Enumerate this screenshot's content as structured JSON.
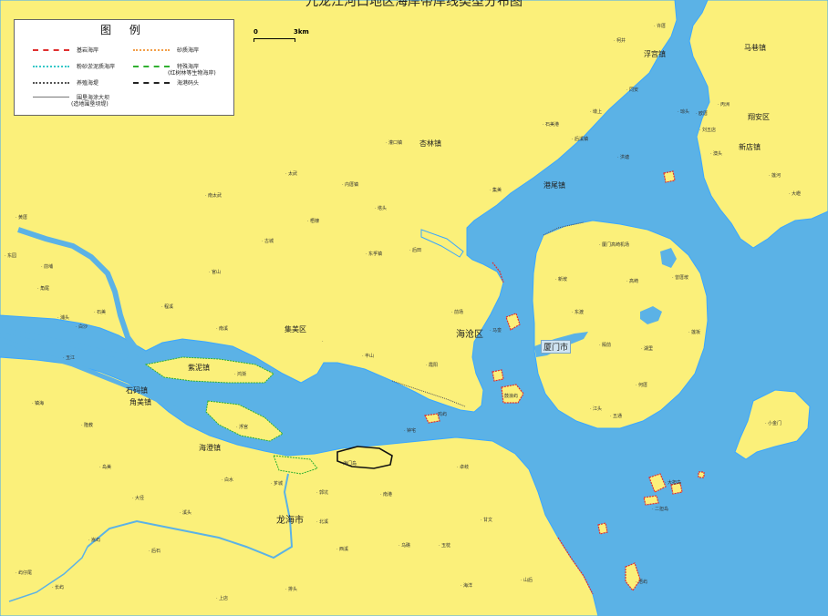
{
  "title": "九龙江河口地区海岸带岸线类型分布图",
  "legend": {
    "title": "图 例",
    "items": [
      {
        "label": "基岩海岸",
        "color": "#e03030",
        "style": "dashed"
      },
      {
        "label": "砂质海岸",
        "color": "#f2a04a",
        "style": "dotted"
      },
      {
        "label": "粉砂淤泥质海岸",
        "color": "#36c8c8",
        "style": "dotted"
      },
      {
        "label": "特殊海岸",
        "sublabel": "(红树林等生物海岸)",
        "color": "#30b030",
        "style": "dashed"
      },
      {
        "label": "养殖海堤",
        "color": "#555555",
        "style": "ticks"
      },
      {
        "label": "海港码头",
        "color": "#222222",
        "style": "crenel"
      },
      {
        "label": "围垦海涂大坝",
        "sublabel": "(造地围垦坝堤)",
        "color": "#777777",
        "style": "solid"
      }
    ]
  },
  "scale": {
    "start": "0",
    "end": "3km"
  },
  "colors": {
    "sea": "#5bb2e6",
    "land": "#fbf07a",
    "coast": "#3aa7ff"
  },
  "districts": [
    {
      "name": "厦门市",
      "style": "boxed"
    },
    {
      "name": "海沧区",
      "style": "big"
    },
    {
      "name": "龙海市",
      "style": "big"
    },
    {
      "name": "翔安区",
      "style": "big"
    },
    {
      "name": "新店镇",
      "style": "normal"
    },
    {
      "name": "马巷镇",
      "style": "normal"
    },
    {
      "name": "角美镇",
      "style": "normal"
    },
    {
      "name": "紫泥镇",
      "style": "normal"
    },
    {
      "name": "海澄镇",
      "style": "normal"
    },
    {
      "name": "港尾镇",
      "style": "normal"
    },
    {
      "name": "浮宫镇",
      "style": "normal"
    },
    {
      "name": "石码镇",
      "style": "normal"
    },
    {
      "name": "集美区",
      "style": "normal"
    },
    {
      "name": "杏林镇",
      "style": "normal"
    },
    {
      "name": "厦门高崎机场",
      "style": "normal"
    },
    {
      "name": "鼓浪屿",
      "style": "normal"
    },
    {
      "name": "小金门",
      "style": "normal"
    },
    {
      "name": "大担岛",
      "style": "normal"
    },
    {
      "name": "二担岛",
      "style": "normal"
    },
    {
      "name": "浯屿",
      "style": "normal"
    },
    {
      "name": "鸡屿",
      "style": "normal"
    },
    {
      "name": "海门岛",
      "style": "normal"
    }
  ],
  "places": [
    "灌口镇",
    "后溪镇",
    "同安",
    "东孚镇",
    "内厝镇",
    "大嶝",
    "莲河",
    "澳头",
    "欧厝",
    "琼头",
    "刘五店",
    "丙洲",
    "集美",
    "后田",
    "前场",
    "马銮",
    "新垵",
    "东渡",
    "高崎",
    "殿前",
    "湖里",
    "江头",
    "莲坂",
    "曾厝垵",
    "何厝",
    "五通",
    "钟宅",
    "前埔",
    "黄厝",
    "浦头",
    "白沙",
    "石美",
    "东园",
    "角尾",
    "玉江",
    "程溪",
    "南溪",
    "鸿渐",
    "浮宫",
    "白水",
    "芗城",
    "郭坑",
    "北溪",
    "西溪",
    "南港",
    "乌礁",
    "玉枕",
    "卓岐",
    "甘文",
    "山后",
    "海洋",
    "排头",
    "上店",
    "后石",
    "嵩屿",
    "长屿",
    "屿仔尾",
    "大径",
    "溪头",
    "岛美",
    "隆教",
    "镇海",
    "古城",
    "官山",
    "梧棣",
    "塔头",
    "太武",
    "南太武",
    "石美港",
    "墩上",
    "洪塘",
    "许厝",
    "柯井",
    "霞阳",
    "丰山"
  ]
}
